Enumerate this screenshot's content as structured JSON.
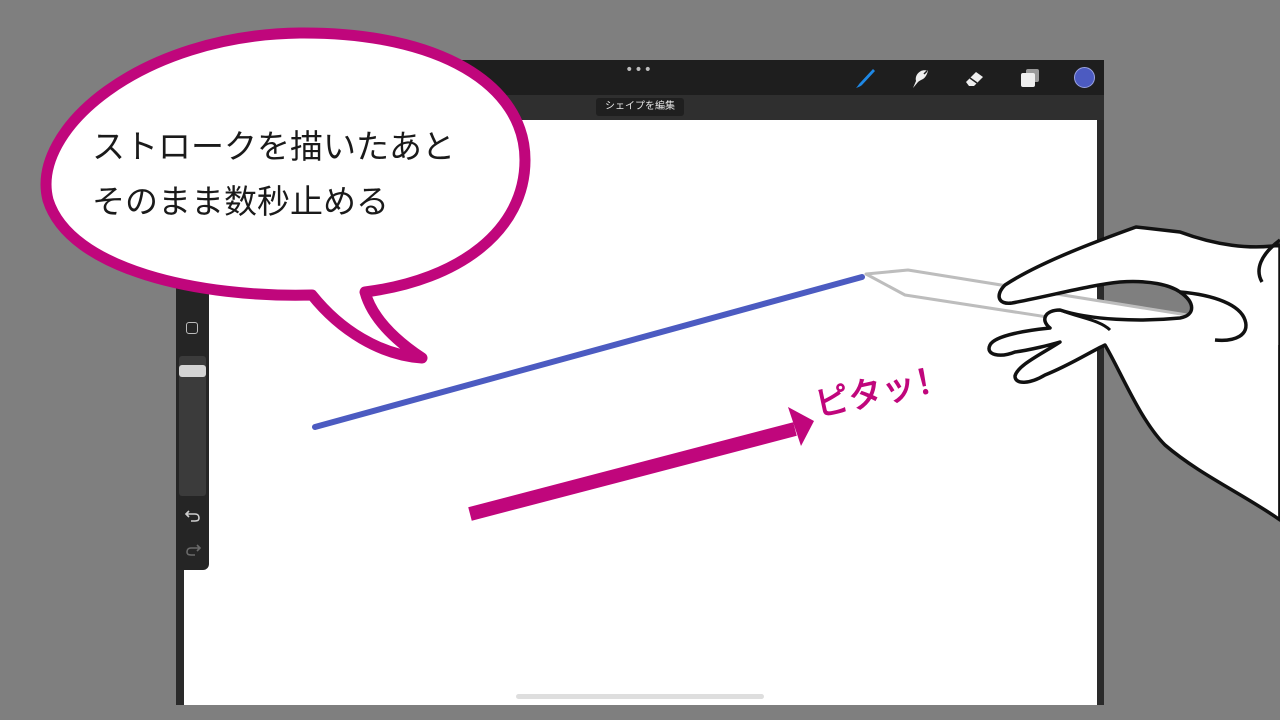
{
  "toolbar": {
    "more_icon": "ellipsis-icon",
    "tools": [
      "brush-icon",
      "smudge-icon",
      "eraser-icon",
      "layers-icon"
    ],
    "active_tool": "brush-icon",
    "active_tool_color": "#1e88e5",
    "current_color": "#4c5bc1"
  },
  "edit_shape_label": "シェイプを編集",
  "sidebar": {
    "opacity_level": 0.95,
    "icons": [
      "square-icon",
      "undo-icon",
      "redo-icon"
    ]
  },
  "stroke": {
    "color": "#4c5bc1"
  },
  "annotation": {
    "bubble_line_1": "ストロークを描いたあと",
    "bubble_line_2": "そのまま数秒止める",
    "bubble_color": "#c0067c",
    "arrow_label": "ピタッ！"
  }
}
